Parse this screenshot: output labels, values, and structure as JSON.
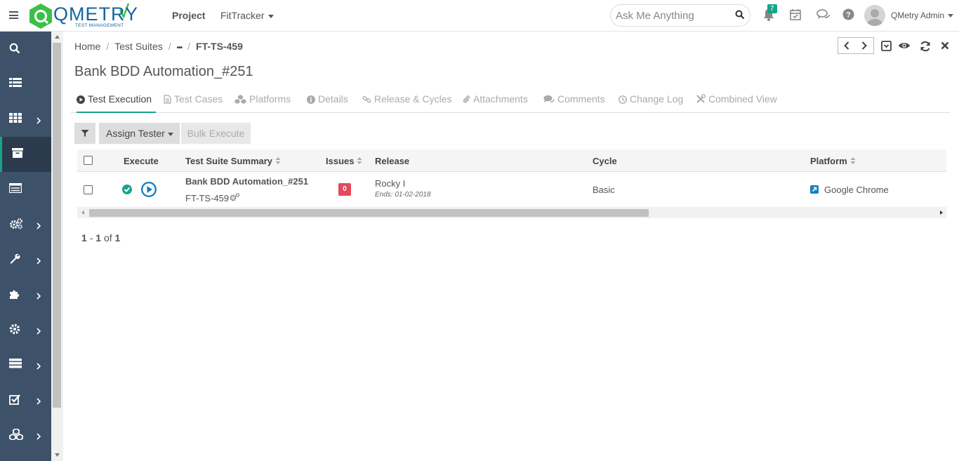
{
  "header": {
    "logo_text": "QMETRY",
    "logo_subtext": "TEST MANAGEMENT",
    "project_label": "Project",
    "tracker_label": "FitTracker",
    "search_placeholder": "Ask Me Anything",
    "notification_count": "7",
    "user_name": "QMetry Admin"
  },
  "breadcrumb": {
    "home": "Home",
    "test_suites": "Test Suites",
    "ellipsis": "•••",
    "current": "FT-TS-459"
  },
  "page": {
    "title": "Bank BDD Automation_#251"
  },
  "tabs": [
    {
      "label": "Test Execution",
      "icon": "play-circle-icon"
    },
    {
      "label": "Test Cases",
      "icon": "document-icon"
    },
    {
      "label": "Platforms",
      "icon": "cubes-icon"
    },
    {
      "label": "Details",
      "icon": "info-icon"
    },
    {
      "label": "Release & Cycles",
      "icon": "link-icon"
    },
    {
      "label": "Attachments",
      "icon": "paperclip-icon"
    },
    {
      "label": "Comments",
      "icon": "comments-icon"
    },
    {
      "label": "Change Log",
      "icon": "clock-icon"
    },
    {
      "label": "Combined View",
      "icon": "tools-icon"
    }
  ],
  "toolbar": {
    "assign_tester_label": "Assign Tester",
    "bulk_execute_label": "Bulk Execute"
  },
  "grid": {
    "columns": {
      "execute": "Execute",
      "summary": "Test Suite Summary",
      "issues": "Issues",
      "release": "Release",
      "cycle": "Cycle",
      "platform": "Platform"
    },
    "rows": [
      {
        "summary": "Bank BDD Automation_#251",
        "key": "FT-TS-459",
        "issues": "0",
        "release": "Rocky I",
        "release_ends": "Ends: 01-02-2018",
        "cycle": "Basic",
        "platform": "Google Chrome"
      }
    ]
  },
  "pager": {
    "from": "1",
    "dash": "-",
    "to": "1",
    "of": "of",
    "total": "1"
  },
  "colors": {
    "accent": "#17a589",
    "sidebar": "#3d5168",
    "sidebar_active": "#2b3b4d",
    "brand_blue": "#1565a0",
    "danger": "#e44a5b"
  }
}
